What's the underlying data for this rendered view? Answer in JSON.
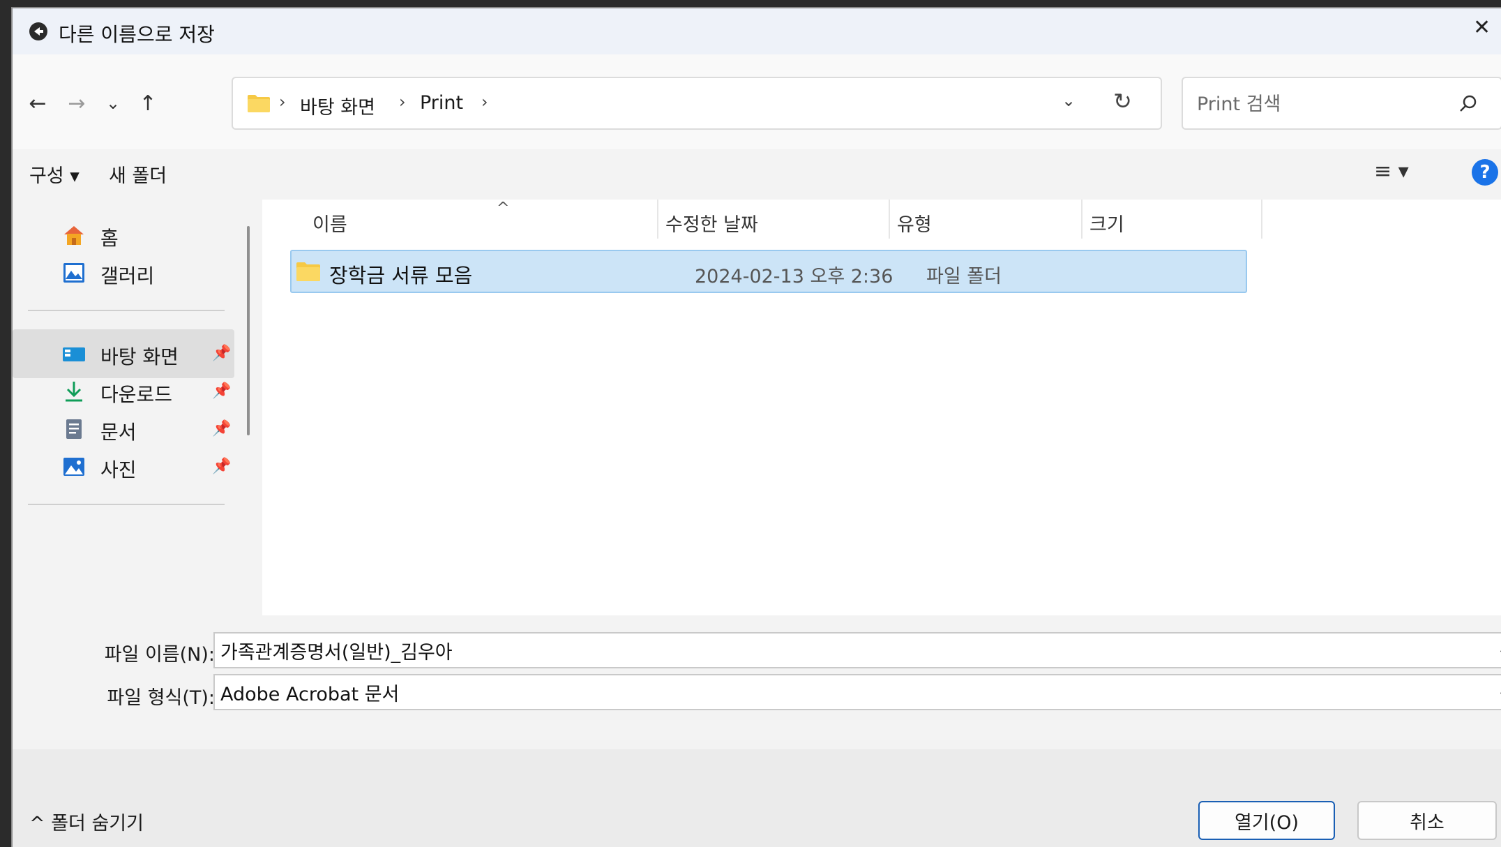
{
  "window": {
    "title": "다른 이름으로 저장",
    "close_glyph": "✕"
  },
  "nav": {
    "back_glyph": "←",
    "forward_glyph": "→",
    "recent_glyph": "⌄",
    "up_glyph": "↑"
  },
  "address": {
    "separator": "›",
    "crumbs": [
      "바탕 화면",
      "Print"
    ],
    "dropdown_glyph": "⌄",
    "refresh_glyph": "↻"
  },
  "search": {
    "placeholder": "Print 검색"
  },
  "commandbar": {
    "organize_label": "구성 ▾",
    "new_folder_label": "새 폴더",
    "view_glyph": "≡ ▾",
    "help_glyph": "?"
  },
  "sidebar": {
    "pin_glyph": "📌",
    "items": [
      {
        "label": "홈",
        "icon": "home-icon"
      },
      {
        "label": "갤러리",
        "icon": "gallery-icon"
      },
      {
        "label": "바탕 화면",
        "icon": "desktop-icon",
        "pinned": true,
        "selected": true
      },
      {
        "label": "다운로드",
        "icon": "download-icon",
        "pinned": true
      },
      {
        "label": "문서",
        "icon": "document-icon",
        "pinned": true
      },
      {
        "label": "사진",
        "icon": "pictures-icon",
        "pinned": true
      }
    ]
  },
  "columns": {
    "name": "이름",
    "modified": "수정한 날짜",
    "type": "유형",
    "size": "크기",
    "sort_glyph": "^"
  },
  "files": [
    {
      "name": "장학금 서류 모음",
      "modified": "2024-02-13 오후 2:36",
      "type": "파일 폴더",
      "size": ""
    }
  ],
  "form": {
    "filename_label": "파일 이름(N):",
    "filename_value": "가족관계증명서(일반)_김우아",
    "filetype_label": "파일 형식(T):",
    "filetype_value": "Adobe Acrobat 문서",
    "chevron_glyph": "⌄"
  },
  "footer": {
    "hide_folders_label": "^  폴더 숨기기",
    "open_label": "열기(O)",
    "cancel_label": "취소"
  },
  "colors": {
    "selection_bg": "#cce4f7",
    "folder_yellow": "#f6c945",
    "accent": "#1a73e8"
  }
}
